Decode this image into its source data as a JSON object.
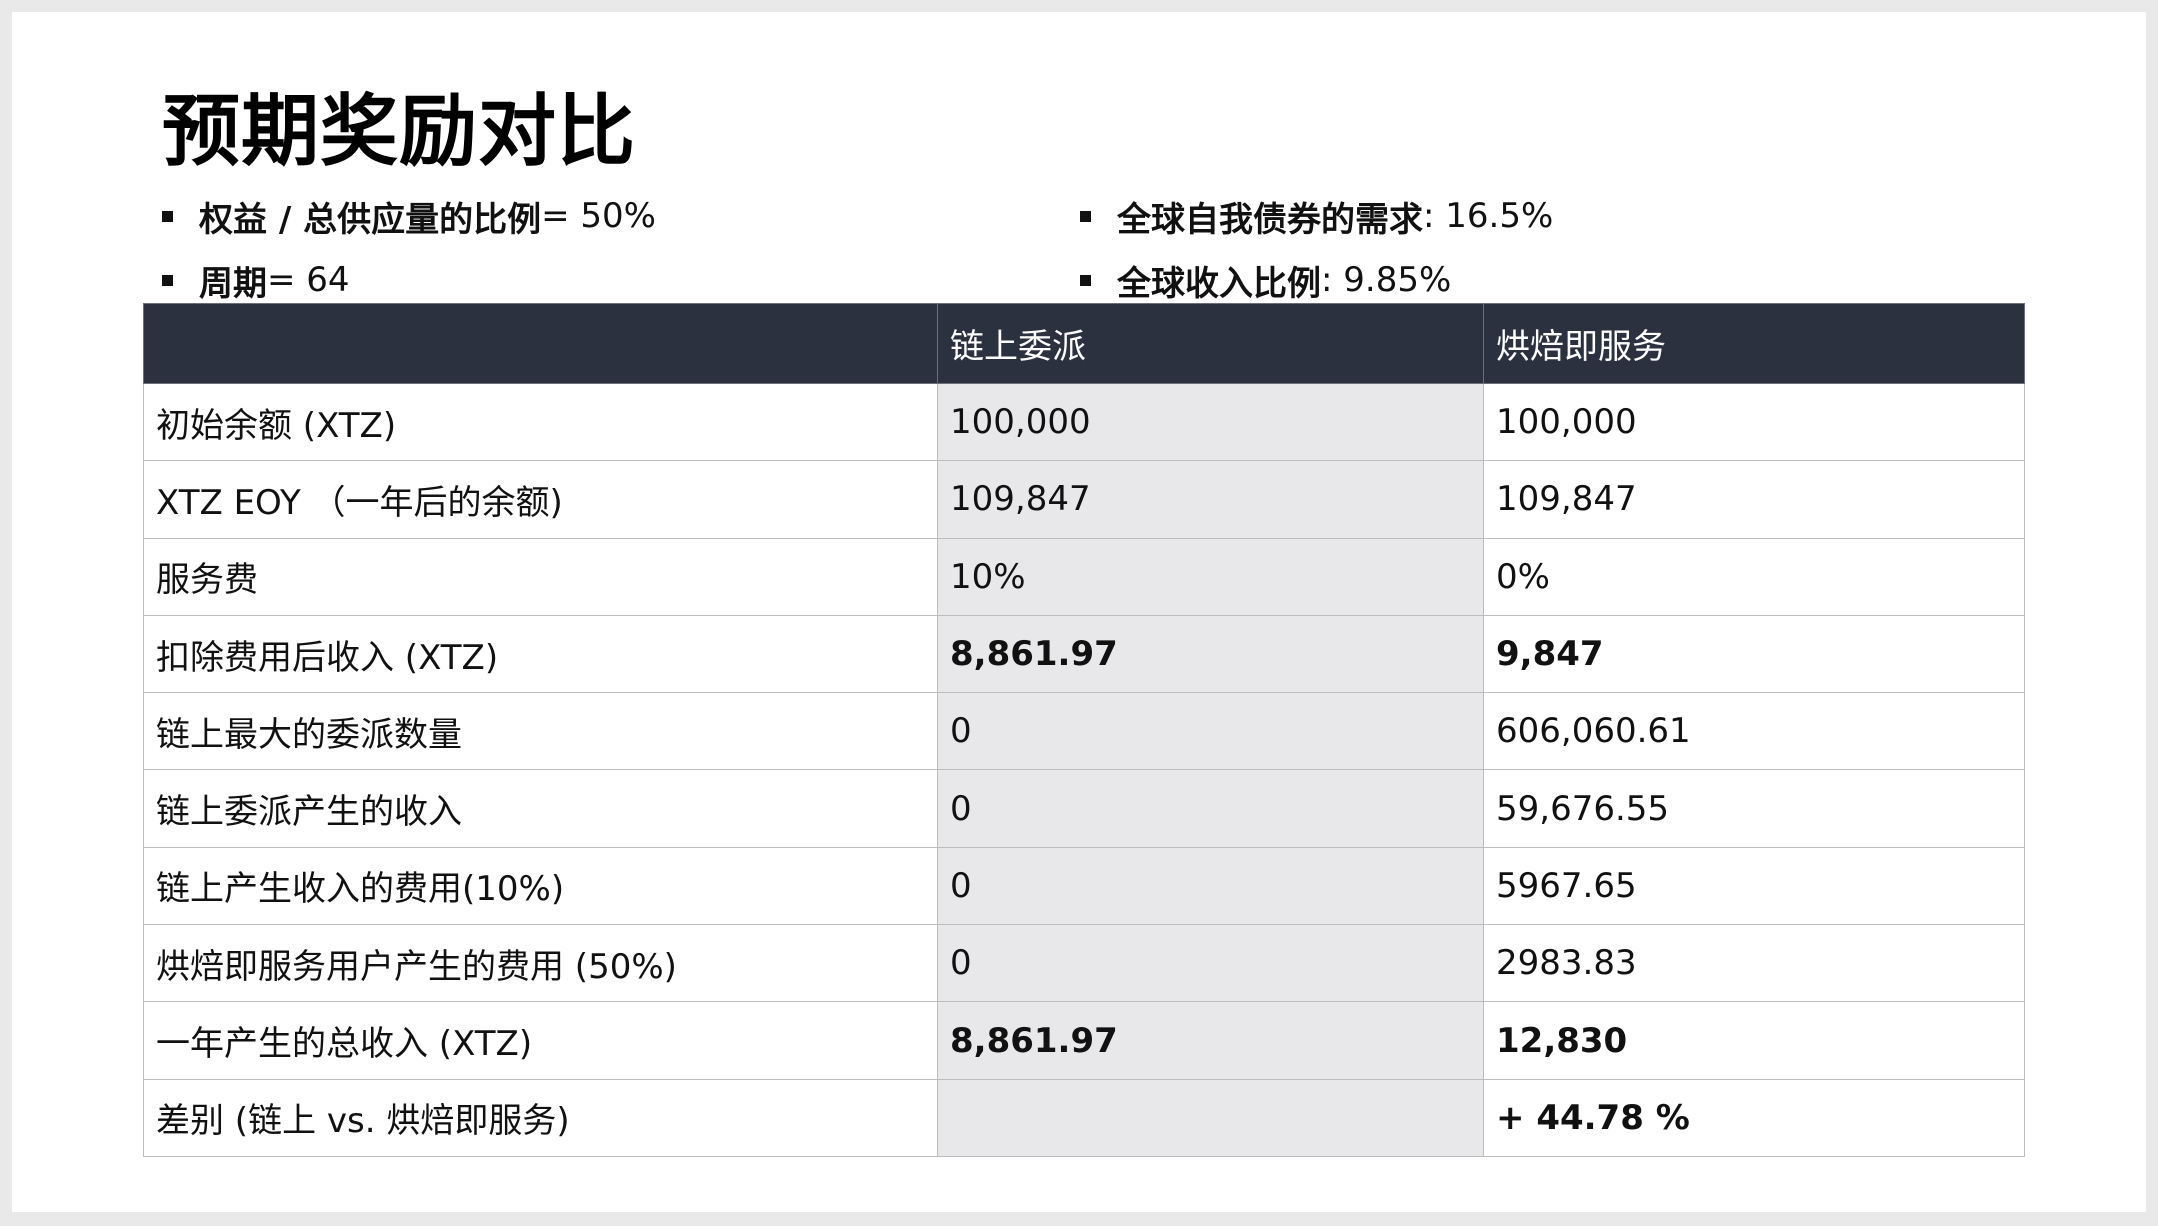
{
  "slide": {
    "title": "预期奖励对比",
    "bullets_left": [
      {
        "bold": "权益 / 总供应量的比例",
        "rest": " = 50%"
      },
      {
        "bold": "周期",
        "rest": " = 64"
      }
    ],
    "bullets_right": [
      {
        "bold": "全球自我债券的需求",
        "rest": ": 16.5%"
      },
      {
        "bold": "全球收入比例",
        "rest": ": 9.85%"
      }
    ]
  },
  "table": {
    "headers": [
      "",
      "链上委派",
      "烘焙即服务"
    ],
    "rows": [
      [
        "初始余额 (XTZ)",
        "100,000",
        "100,000"
      ],
      [
        "XTZ EOY （一年后的余额)",
        "109,847",
        "109,847"
      ],
      [
        "服务费",
        "10%",
        "0%"
      ],
      [
        "扣除费用后收入 (XTZ)",
        "8,861.97",
        "9,847"
      ],
      [
        "链上最大的委派数量",
        "0",
        "606,060.61"
      ],
      [
        "链上委派产生的收入",
        "0",
        "59,676.55"
      ],
      [
        "链上产生收入的费用(10%)",
        "0",
        "5967.65"
      ],
      [
        "烘焙即服务用户产生的费用 (50%)",
        "0",
        "2983.83"
      ],
      [
        "一年产生的总收入 (XTZ)",
        "8,861.97",
        "12,830"
      ],
      [
        "差别 (链上 vs. 烘焙即服务)",
        "",
        "+ 44.78 %"
      ]
    ]
  },
  "colors": {
    "header_bg": "#2c3140",
    "middle_column_bg": "#e8e8ea",
    "fee_red": "#a52a1f",
    "income_green": "#3f5a2a"
  }
}
